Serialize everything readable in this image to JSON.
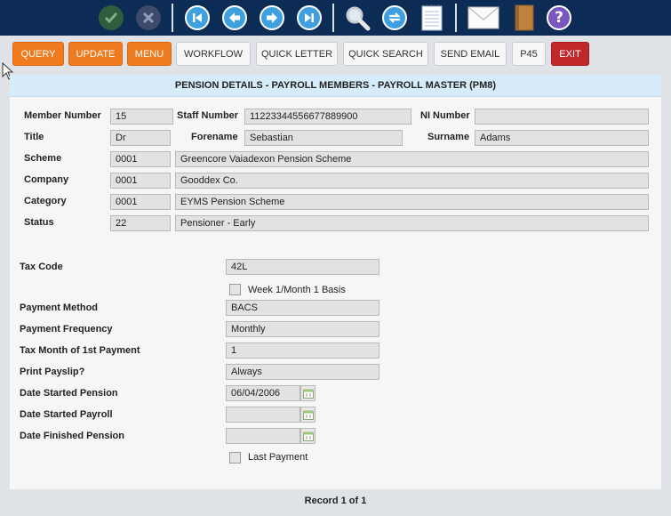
{
  "actions": {
    "query": "QUERY",
    "update": "UPDATE",
    "menu": "MENU",
    "workflow": "WORKFLOW",
    "quick_letter": "QUICK LETTER",
    "quick_search": "QUICK SEARCH",
    "send_email": "SEND EMAIL",
    "p45": "P45",
    "exit": "EXIT"
  },
  "colors": {
    "toolbar": "#0c2b55",
    "orange": "#f07b1e",
    "red": "#c0282b",
    "header": "#d6ecfa"
  },
  "header": {
    "title": "PENSION DETAILS - PAYROLL MEMBERS - PAYROLL MASTER (PM8)"
  },
  "member": {
    "member_number_label": "Member Number",
    "member_number": "15",
    "staff_number_label": "Staff Number",
    "staff_number": "11223344556677889900",
    "ni_number_label": "NI Number",
    "ni_number": "",
    "title_label": "Title",
    "title": "Dr",
    "forename_label": "Forename",
    "forename": "Sebastian",
    "surname_label": "Surname",
    "surname": "Adams",
    "scheme_label": "Scheme",
    "scheme_code": "0001",
    "scheme_name": "Greencore Vaiadexon Pension Scheme",
    "company_label": "Company",
    "company_code": "0001",
    "company_name": "Gooddex Co.",
    "category_label": "Category",
    "category_code": "0001",
    "category_name": "EYMS Pension Scheme",
    "status_label": "Status",
    "status_code": "22",
    "status_name": "Pensioner - Early"
  },
  "payroll": {
    "tax_code_label": "Tax Code",
    "tax_code": "42L",
    "week1_label": "Week 1/Month 1 Basis",
    "payment_method_label": "Payment Method",
    "payment_method": "BACS",
    "payment_frequency_label": "Payment Frequency",
    "payment_frequency": "Monthly",
    "tax_month_label": "Tax Month of 1st Payment",
    "tax_month": "1",
    "print_payslip_label": "Print Payslip?",
    "print_payslip": "Always",
    "date_started_pension_label": "Date Started Pension",
    "date_started_pension": "06/04/2006",
    "date_started_payroll_label": "Date Started Payroll",
    "date_started_payroll": "",
    "date_finished_pension_label": "Date Finished Pension",
    "date_finished_pension": "",
    "last_payment_label": "Last Payment"
  },
  "footer": {
    "record": "Record 1 of 1"
  }
}
